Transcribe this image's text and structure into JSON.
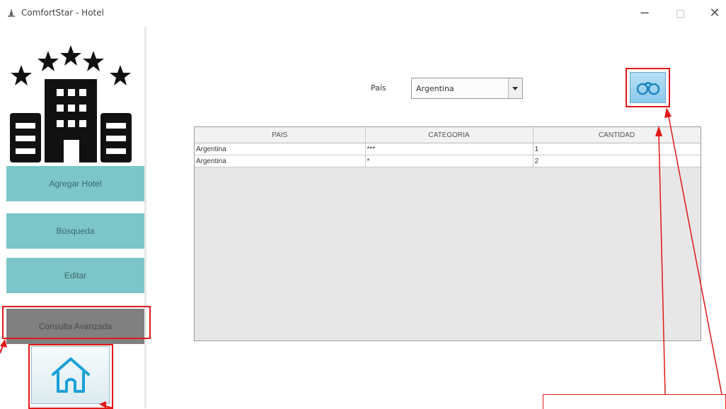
{
  "window": {
    "title": "ComfortStar - Hotel",
    "minimize_label": "−",
    "close_label": "✕"
  },
  "sidebar": {
    "logo_icon": "hotel-five-stars-icon",
    "items": [
      {
        "label": "Agregar Hotel"
      },
      {
        "label": "Búsqueda"
      },
      {
        "label": "Editar"
      },
      {
        "label": "Consulta Avanzada"
      }
    ],
    "home_icon": "home-icon"
  },
  "filter": {
    "label": "País",
    "selected": "Argentina"
  },
  "search_button": {
    "icon": "binoculars-icon"
  },
  "table": {
    "headers": [
      "PAIS",
      "CATEGORIA",
      "CANTIDAD"
    ],
    "rows": [
      [
        "Argentina",
        "***",
        "1"
      ],
      [
        "Argentina",
        "*",
        "2"
      ]
    ]
  },
  "colors": {
    "nav_button": "#7cc5c9",
    "nav_active": "#808080",
    "annotation": "#e01818"
  }
}
